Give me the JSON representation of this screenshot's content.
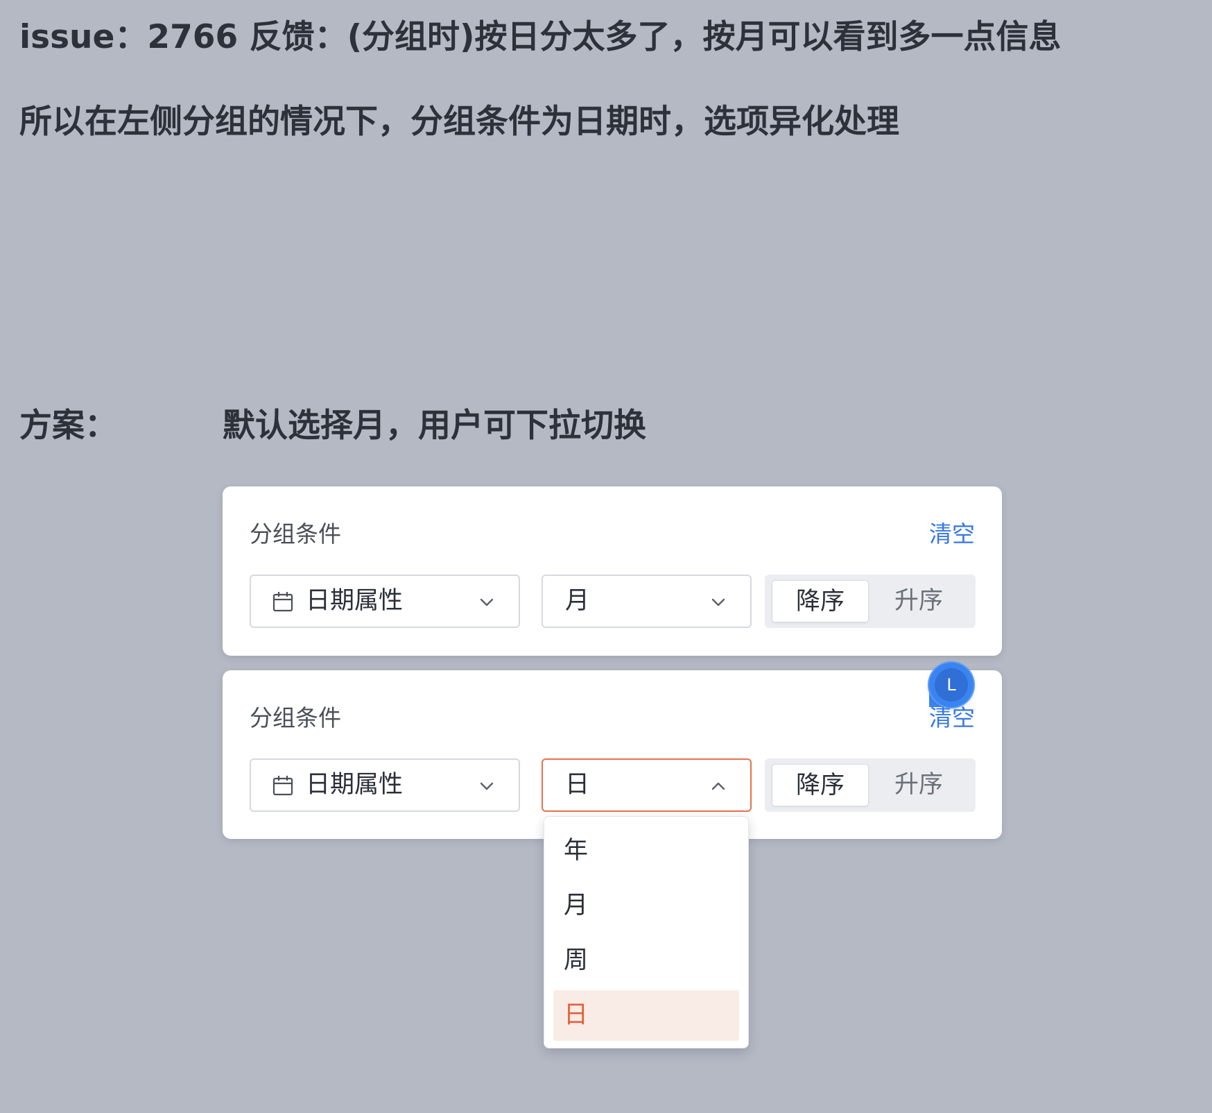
{
  "header": {
    "issue_line": "issue：2766 反馈：(分组时)按日分太多了，按月可以看到多一点信息",
    "desc_line": "所以在左侧分组的情况下，分组条件为日期时，选项异化处理"
  },
  "plan": {
    "label": "方案：",
    "text": "默认选择月，用户可下拉切换"
  },
  "card1": {
    "title": "分组条件",
    "clear_label": "清空",
    "field_value": "日期属性",
    "granularity_value": "月",
    "order_desc": "降序",
    "order_asc": "升序"
  },
  "card2": {
    "title": "分组条件",
    "clear_label": "清空",
    "field_value": "日期属性",
    "granularity_value": "日",
    "order_desc": "降序",
    "order_asc": "升序"
  },
  "avatar": {
    "initial": "L"
  },
  "dropdown": {
    "options": [
      "年",
      "月",
      "周",
      "日"
    ],
    "selected": "日"
  },
  "colors": {
    "background": "#b5b9c4",
    "link_blue": "#3677e8",
    "active_orange": "#e8714a",
    "selected_bg": "#f9ece6"
  },
  "icons": [
    "calendar-icon",
    "chevron-down-icon",
    "chevron-up-icon"
  ]
}
